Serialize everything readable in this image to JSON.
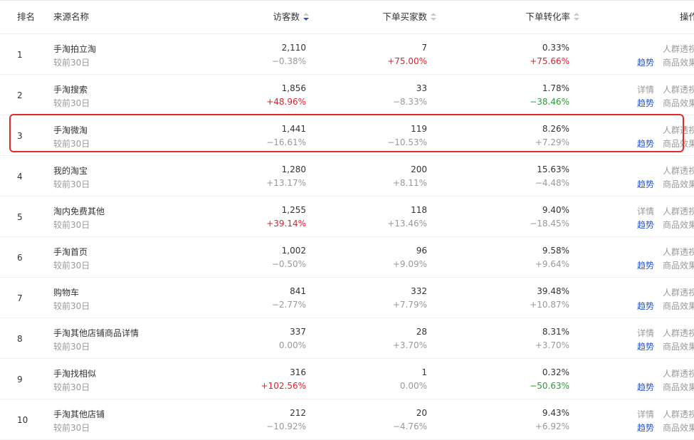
{
  "header": {
    "rank": "排名",
    "source": "来源名称",
    "visitors": "访客数",
    "buyers": "下单买家数",
    "rate": "下单转化率",
    "ops": "操作"
  },
  "colors": {
    "accent": "#2b56c5",
    "up": "#e5202c",
    "down": "#2e9b3a",
    "highlight": "#e32a2a"
  },
  "rows": [
    {
      "rank": "1",
      "name": "手淘拍立淘",
      "sub": "较前30日",
      "visitors": "2,110",
      "visitors_change": "−0.38%",
      "visitors_tone": "neg",
      "buyers": "7",
      "buyers_change": "+75.00%",
      "buyers_tone": "red",
      "rate": "0.33%",
      "rate_change": "+75.66%",
      "rate_tone": "red",
      "detail": "",
      "trend": "趋势",
      "crowd": "人群透视",
      "effect": "商品效果"
    },
    {
      "rank": "2",
      "name": "手淘搜索",
      "sub": "较前30日",
      "visitors": "1,856",
      "visitors_change": "+48.96%",
      "visitors_tone": "red",
      "buyers": "33",
      "buyers_change": "−8.33%",
      "buyers_tone": "neg",
      "rate": "1.78%",
      "rate_change": "−38.46%",
      "rate_tone": "green",
      "detail": "详情",
      "trend": "趋势",
      "crowd": "人群透视",
      "effect": "商品效果"
    },
    {
      "rank": "3",
      "name": "手淘微淘",
      "sub": "较前30日",
      "visitors": "1,441",
      "visitors_change": "−16.61%",
      "visitors_tone": "neg",
      "buyers": "119",
      "buyers_change": "−10.53%",
      "buyers_tone": "neg",
      "rate": "8.26%",
      "rate_change": "+7.29%",
      "rate_tone": "pos",
      "detail": "",
      "trend": "趋势",
      "crowd": "人群透视",
      "effect": "商品效果"
    },
    {
      "rank": "4",
      "name": "我的淘宝",
      "sub": "较前30日",
      "visitors": "1,280",
      "visitors_change": "+13.17%",
      "visitors_tone": "pos",
      "buyers": "200",
      "buyers_change": "+8.11%",
      "buyers_tone": "pos",
      "rate": "15.63%",
      "rate_change": "−4.48%",
      "rate_tone": "neg",
      "detail": "",
      "trend": "趋势",
      "crowd": "人群透视",
      "effect": "商品效果"
    },
    {
      "rank": "5",
      "name": "淘内免费其他",
      "sub": "较前30日",
      "visitors": "1,255",
      "visitors_change": "+39.14%",
      "visitors_tone": "red",
      "buyers": "118",
      "buyers_change": "+13.46%",
      "buyers_tone": "pos",
      "rate": "9.40%",
      "rate_change": "−18.45%",
      "rate_tone": "neg",
      "detail": "详情",
      "trend": "趋势",
      "crowd": "人群透视",
      "effect": "商品效果"
    },
    {
      "rank": "6",
      "name": "手淘首页",
      "sub": "较前30日",
      "visitors": "1,002",
      "visitors_change": "−0.50%",
      "visitors_tone": "neg",
      "buyers": "96",
      "buyers_change": "+9.09%",
      "buyers_tone": "pos",
      "rate": "9.58%",
      "rate_change": "+9.64%",
      "rate_tone": "pos",
      "detail": "",
      "trend": "趋势",
      "crowd": "人群透视",
      "effect": "商品效果"
    },
    {
      "rank": "7",
      "name": "购物车",
      "sub": "较前30日",
      "visitors": "841",
      "visitors_change": "−2.77%",
      "visitors_tone": "neg",
      "buyers": "332",
      "buyers_change": "+7.79%",
      "buyers_tone": "pos",
      "rate": "39.48%",
      "rate_change": "+10.87%",
      "rate_tone": "pos",
      "detail": "",
      "trend": "趋势",
      "crowd": "人群透视",
      "effect": "商品效果"
    },
    {
      "rank": "8",
      "name": "手淘其他店铺商品详情",
      "sub": "较前30日",
      "visitors": "337",
      "visitors_change": "0.00%",
      "visitors_tone": "neg",
      "buyers": "28",
      "buyers_change": "+3.70%",
      "buyers_tone": "pos",
      "rate": "8.31%",
      "rate_change": "+3.70%",
      "rate_tone": "pos",
      "detail": "详情",
      "trend": "趋势",
      "crowd": "人群透视",
      "effect": "商品效果"
    },
    {
      "rank": "9",
      "name": "手淘找相似",
      "sub": "较前30日",
      "visitors": "316",
      "visitors_change": "+102.56%",
      "visitors_tone": "red",
      "buyers": "1",
      "buyers_change": "0.00%",
      "buyers_tone": "neg",
      "rate": "0.32%",
      "rate_change": "−50.63%",
      "rate_tone": "green",
      "detail": "",
      "trend": "趋势",
      "crowd": "人群透视",
      "effect": "商品效果"
    },
    {
      "rank": "10",
      "name": "手淘其他店铺",
      "sub": "较前30日",
      "visitors": "212",
      "visitors_change": "−10.92%",
      "visitors_tone": "neg",
      "buyers": "20",
      "buyers_change": "−4.76%",
      "buyers_tone": "neg",
      "rate": "9.43%",
      "rate_change": "+6.92%",
      "rate_tone": "pos",
      "detail": "详情",
      "trend": "趋势",
      "crowd": "人群透视",
      "effect": "商品效果"
    }
  ]
}
